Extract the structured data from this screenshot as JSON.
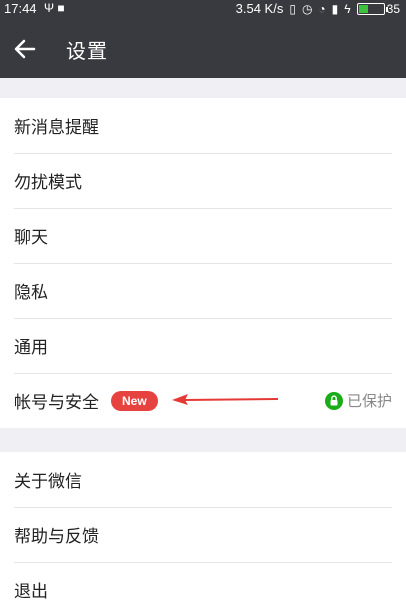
{
  "status_bar": {
    "time": "17:44",
    "left_icons": "Ψ ■",
    "speed": "3.54 K/s",
    "battery": "35"
  },
  "header": {
    "title": "设置"
  },
  "settings": {
    "group1": [
      {
        "label": "新消息提醒"
      },
      {
        "label": "勿扰模式"
      },
      {
        "label": "聊天"
      },
      {
        "label": "隐私"
      },
      {
        "label": "通用"
      },
      {
        "label": "帐号与安全",
        "badge": "New",
        "status": "已保护"
      }
    ],
    "group2": [
      {
        "label": "关于微信"
      },
      {
        "label": "帮助与反馈"
      },
      {
        "label": "退出"
      }
    ]
  },
  "colors": {
    "header_bg": "#393a3f",
    "badge_bg": "#e64340",
    "lock_green": "#1aad19",
    "page_bg": "#efeff4"
  }
}
